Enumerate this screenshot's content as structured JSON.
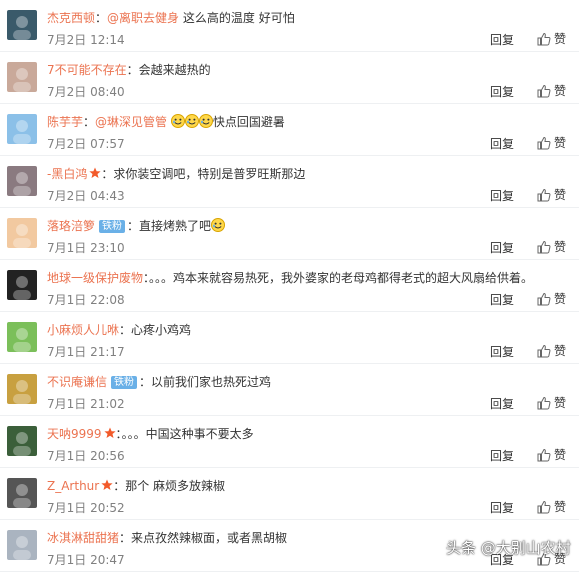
{
  "comments": [
    {
      "user": "杰克西顿",
      "badge": null,
      "star": false,
      "mention": "@离职去健身",
      "text": "这么高的温度  好可怕",
      "time": "7月2日 12:14",
      "avatar_color": "#3a5a6a",
      "avatar_icon": "landscape-avatar"
    },
    {
      "user": "7不可能不存在",
      "badge": null,
      "star": false,
      "mention": null,
      "text": "会越来越热的",
      "time": "7月2日 08:40",
      "avatar_color": "#c9a99a",
      "avatar_icon": "girl-avatar"
    },
    {
      "user": "陈芋芋",
      "badge": null,
      "star": false,
      "mention": "@琳深见管管",
      "text": "快点回国避暑",
      "emojis": 3,
      "time": "7月2日 07:57",
      "avatar_color": "#8bc0e8",
      "avatar_icon": "cartoon-avatar"
    },
    {
      "user": "-黑白鸿",
      "badge": null,
      "star": true,
      "mention": null,
      "text": "求你装空调吧，特别是普罗旺斯那边",
      "time": "7月2日 04:43",
      "avatar_color": "#8a7a80",
      "avatar_icon": "photo-avatar"
    },
    {
      "user": "落珞涪箩",
      "badge": "铁粉",
      "star": false,
      "mention": null,
      "text": "直接烤熟了吧",
      "emojis": 1,
      "time": "7月1日 23:10",
      "avatar_color": "#f2c9a0",
      "avatar_icon": "kid-avatar"
    },
    {
      "user": "地球一级保护废物",
      "badge": null,
      "star": false,
      "mention": null,
      "text": "。。。鸡本来就容易热死，我外婆家的老母鸡都得老式的超大风扇给供着。",
      "time": "7月1日 22:08",
      "avatar_color": "#222222",
      "avatar_icon": "cat-avatar"
    },
    {
      "user": "小麻烦人儿咻",
      "badge": null,
      "star": false,
      "mention": null,
      "text": "心疼小鸡鸡",
      "time": "7月1日 21:17",
      "avatar_color": "#7bbf5a",
      "avatar_icon": "cartoon-avatar"
    },
    {
      "user": "不识庵谦信",
      "badge": "铁粉",
      "star": false,
      "mention": null,
      "text": "以前我们家也热死过鸡",
      "time": "7月1日 21:02",
      "avatar_color": "#c8a040",
      "avatar_icon": "anime-avatar"
    },
    {
      "user": "天呐9999",
      "badge": null,
      "star": true,
      "mention": null,
      "text": "。。。中国这种事不要太多",
      "time": "7月1日 20:56",
      "avatar_color": "#3b5f3a",
      "avatar_icon": "photo-avatar"
    },
    {
      "user": "Z_Arthur",
      "badge": null,
      "star": true,
      "mention": null,
      "text": "那个  麻烦多放辣椒",
      "time": "7月1日 20:52",
      "avatar_color": "#555555",
      "avatar_icon": "anime-avatar"
    },
    {
      "user": "冰淇淋甜甜猪",
      "badge": null,
      "star": false,
      "mention": null,
      "text": "来点孜然辣椒面，或者黑胡椒",
      "time": "7月1日 20:47",
      "avatar_color": "#aab4c0",
      "avatar_icon": "anime-avatar"
    }
  ],
  "actions": {
    "reply_label": "回复"
  },
  "colors": {
    "username": "#eb7350",
    "badge": "#6ab0e7",
    "star": "#f25a2a"
  },
  "watermark": "头条 @大别山农村"
}
